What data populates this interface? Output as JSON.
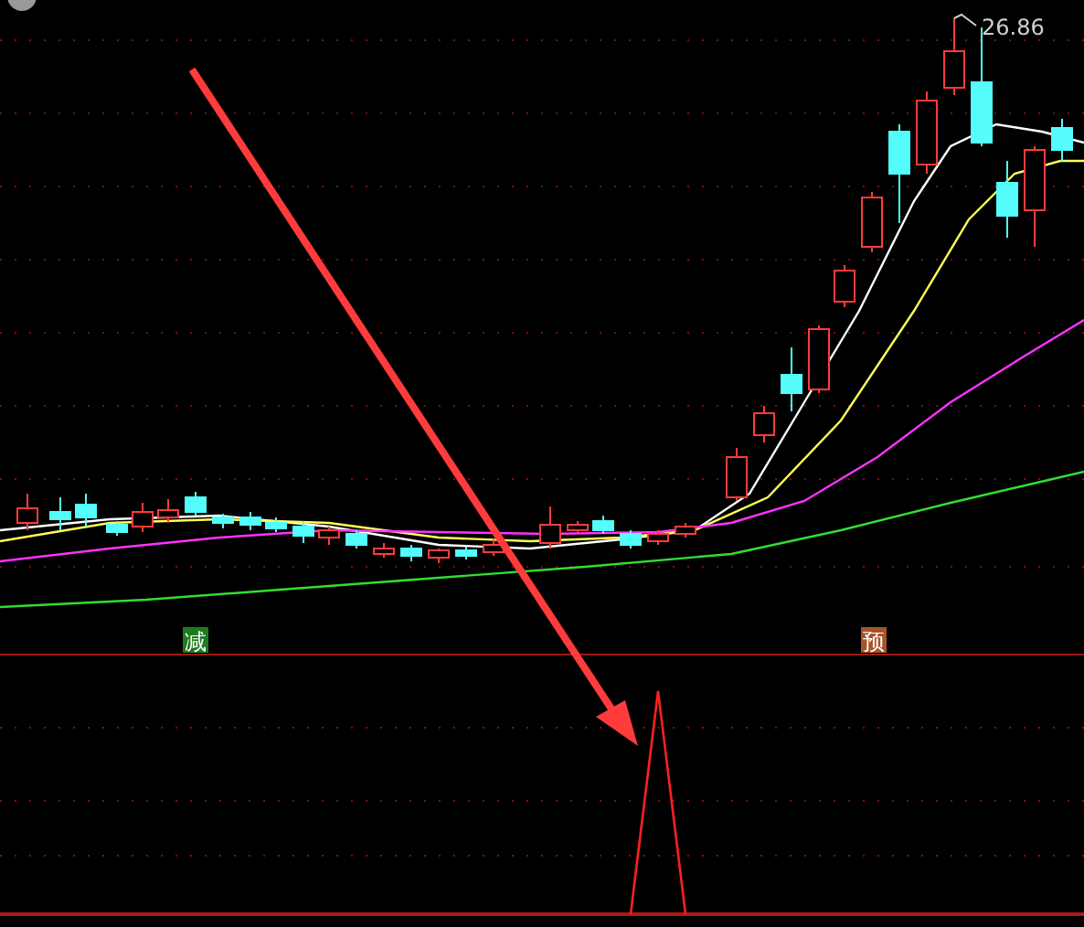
{
  "price_panel": {
    "high_label": "26.86",
    "signals": [
      {
        "text": "减",
        "color": "#1e7a1e"
      },
      {
        "text": "预",
        "color": "#a8532a"
      }
    ]
  }
}
